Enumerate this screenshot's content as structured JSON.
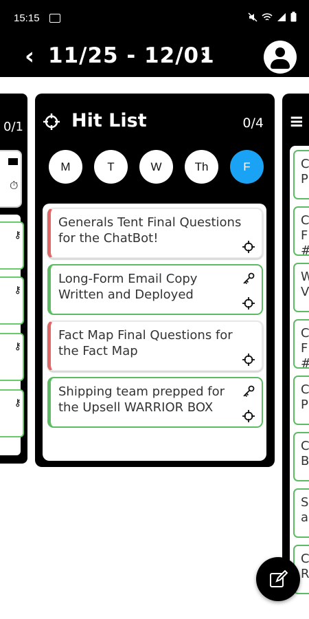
{
  "status_bar": {
    "time": "15:15",
    "icons": [
      "gallery-icon",
      "mute-icon",
      "wifi-icon",
      "signal-icon",
      "battery-icon"
    ]
  },
  "header": {
    "date_range": "11/25 - 12/01",
    "prev_icon": "chevron-left-icon",
    "next_icon": "chevron-right-icon",
    "profile_icon": "account-icon"
  },
  "left_column": {
    "count": "0/1"
  },
  "main_column": {
    "icon": "crosshair-icon",
    "title": "Hit List",
    "count": "0/4",
    "days": [
      {
        "label": "M",
        "active": false
      },
      {
        "label": "T",
        "active": false
      },
      {
        "label": "W",
        "active": false
      },
      {
        "label": "Th",
        "active": false
      },
      {
        "label": "F",
        "active": true
      }
    ],
    "cards": [
      {
        "text": "Generals Tent Final Questions for the ChatBot!",
        "status": "red",
        "icons": [
          "crosshair-icon"
        ]
      },
      {
        "text": "Long-Form Email Copy Written and Deployed",
        "status": "green",
        "icons": [
          "key-icon",
          "crosshair-icon"
        ]
      },
      {
        "text": "Fact Map Final Questions for the Fact Map",
        "status": "red",
        "icons": [
          "crosshair-icon"
        ]
      },
      {
        "text": "Shipping team prepped for the Upsell WARRIOR BOX",
        "status": "green",
        "icons": [
          "key-icon",
          "crosshair-icon"
        ]
      }
    ]
  },
  "right_column": {
    "stubs": [
      "C\nP",
      "C\nF\n#",
      "W\nV",
      "C\nF\n#",
      "C\nP",
      "C\nB",
      "S\na",
      "C\nR"
    ]
  },
  "fab": {
    "icon": "edit-icon"
  },
  "colors": {
    "accent": "#1aa3f5",
    "status_red": "#e06666",
    "status_green": "#5dbb63",
    "background": "#000000"
  }
}
